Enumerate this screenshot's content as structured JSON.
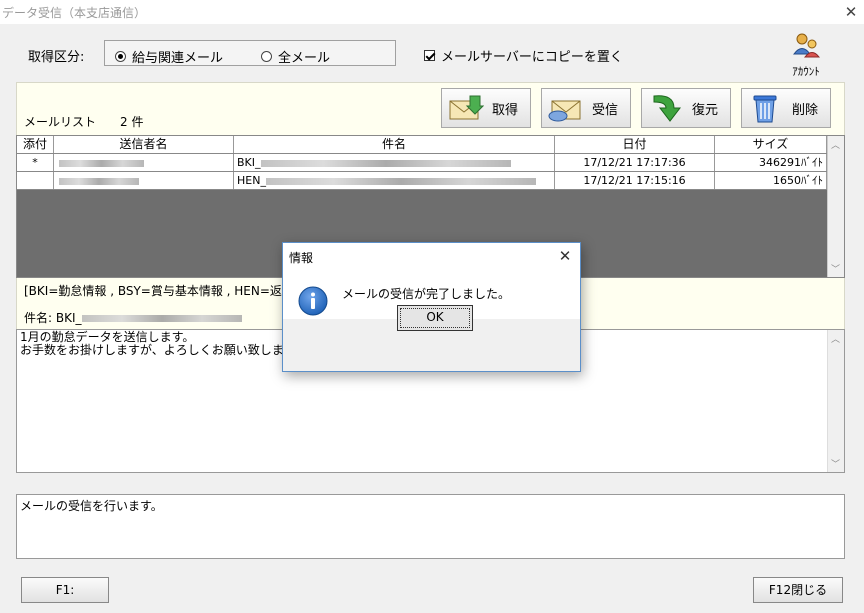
{
  "window": {
    "title": "データ受信（本支店通信）",
    "close_glyph": "✕"
  },
  "acquisition": {
    "label": "取得区分:",
    "options": [
      {
        "label": "給与関連メール",
        "selected": true
      },
      {
        "label": "全メール",
        "selected": false
      }
    ]
  },
  "copy_to_server": {
    "label": "メールサーバーにコピーを置く",
    "checked": true
  },
  "account": {
    "label": "ｱｶｳﾝﾄ",
    "icon": "account-icon"
  },
  "mail_list": {
    "title": "メールリスト",
    "count": "2 件"
  },
  "toolbar": {
    "fetch": {
      "label": "取得",
      "icon": "envelope-in-icon"
    },
    "receive": {
      "label": "受信",
      "icon": "envelope-receive-icon"
    },
    "restore": {
      "label": "復元",
      "icon": "green-arrow-icon"
    },
    "delete": {
      "label": "削除",
      "icon": "trash-can-icon"
    }
  },
  "table": {
    "columns": [
      "添付",
      "送信者名",
      "件名",
      "日付",
      "サイズ"
    ],
    "rows": [
      {
        "attach": "*",
        "sender": "",
        "subject_prefix": "BKI_",
        "date": "17/12/21 17:17:36",
        "size": "346291ﾊﾞｲﾄ"
      },
      {
        "attach": "",
        "sender": "",
        "subject_prefix": "HEN_",
        "date": "17/12/21 17:15:16",
        "size": "1650ﾊﾞｲﾄ"
      }
    ]
  },
  "legend": {
    "text": "[BKI=勤怠情報 , BSY=賞与基本情報 , HEN=返"
  },
  "subject": {
    "label": "件名: BKI_"
  },
  "body": {
    "text": "1月の勤怠データを送信します。\nお手数をお掛けしますが、よろしくお願い致します"
  },
  "status": {
    "text": "メールの受信を行います。"
  },
  "footer": {
    "f1": "F1:",
    "f12": "F12閉じる"
  },
  "dialog": {
    "title": "情報",
    "message": "メールの受信が完了しました。",
    "ok": "OK",
    "icon": "info-icon",
    "close_glyph": "✕"
  },
  "colors": {
    "grid_empty": "#6e6e6e",
    "panel_bg": "#fffff0",
    "dialog_border": "#5b8fc9",
    "info_icon": "#1b5fb5"
  }
}
